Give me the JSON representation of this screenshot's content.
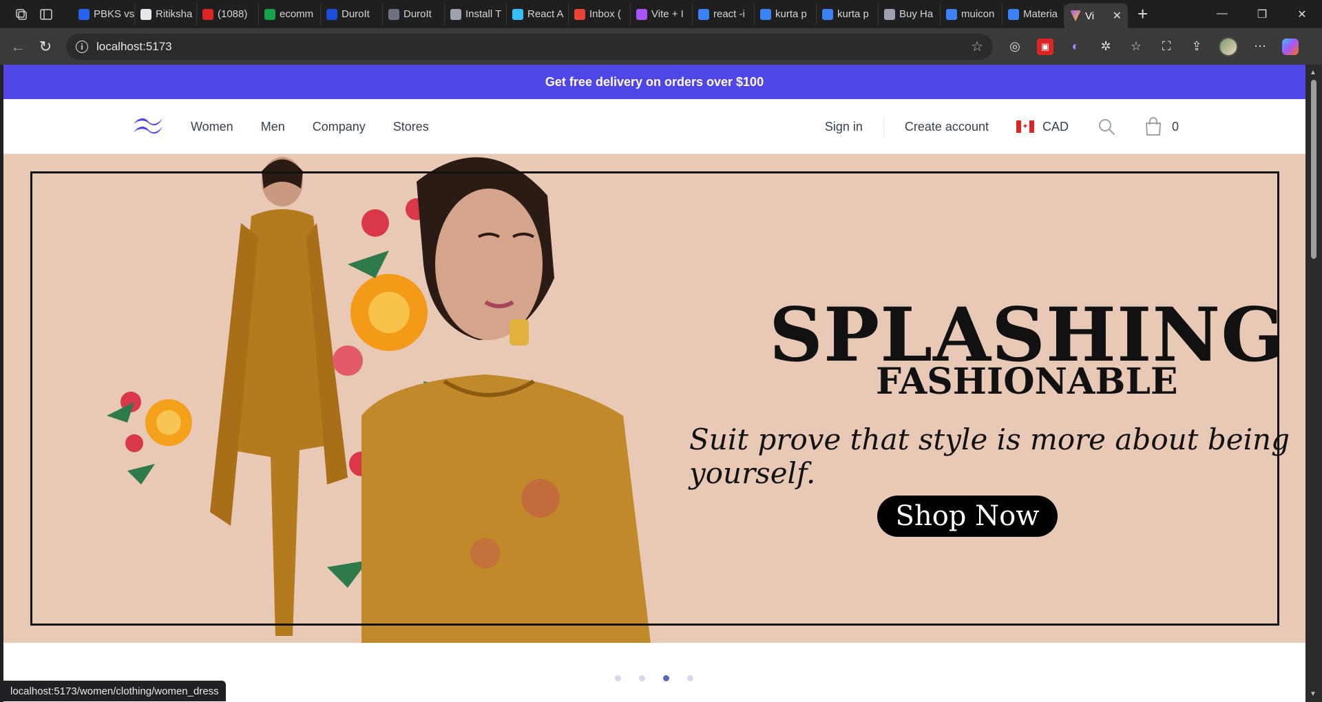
{
  "browser": {
    "tabs": [
      {
        "label": "PBKS vs",
        "color": "#2563eb"
      },
      {
        "label": "Ritiksha",
        "color": "#e5e7eb"
      },
      {
        "label": "(1088)",
        "color": "#dc2626"
      },
      {
        "label": "ecomm",
        "color": "#16a34a"
      },
      {
        "label": "DuroIt",
        "color": "#1d4ed8"
      },
      {
        "label": "DuroIt",
        "color": "#6b7280"
      },
      {
        "label": "Install T",
        "color": "#9ca3af"
      },
      {
        "label": "React A",
        "color": "#38bdf8"
      },
      {
        "label": "Inbox (",
        "color": "#ea4335"
      },
      {
        "label": "Vite + I",
        "color": "#a855f7"
      },
      {
        "label": "react -i",
        "color": "#3b82f6"
      },
      {
        "label": "kurta p",
        "color": "#3b82f6"
      },
      {
        "label": "kurta p",
        "color": "#3b82f6"
      },
      {
        "label": "Buy Ha",
        "color": "#9ca3af"
      },
      {
        "label": "muicon",
        "color": "#3b82f6"
      },
      {
        "label": "Materia",
        "color": "#3b82f6"
      }
    ],
    "active_tab": {
      "label": "Vi",
      "color": "#a855f7"
    },
    "url": "localhost:5173",
    "status_url": "localhost:5173/women/clothing/women_dress"
  },
  "promo": {
    "text": "Get free delivery on orders over $100"
  },
  "nav": {
    "links": [
      "Women",
      "Men",
      "Company",
      "Stores"
    ],
    "sign_in": "Sign in",
    "create_account": "Create account",
    "currency": "CAD",
    "cart_count": "0"
  },
  "hero": {
    "title_line1": "SPLASHING",
    "title_line2": "FASHIONABLE",
    "tagline": "Suit prove that style is more about being yourself.",
    "cta": "Shop Now"
  },
  "carousel": {
    "count": 4,
    "active_index": 2
  },
  "colors": {
    "accent": "#4f46e5",
    "hero_bg": "#e8c9b5",
    "garment": "#c08a2a"
  }
}
